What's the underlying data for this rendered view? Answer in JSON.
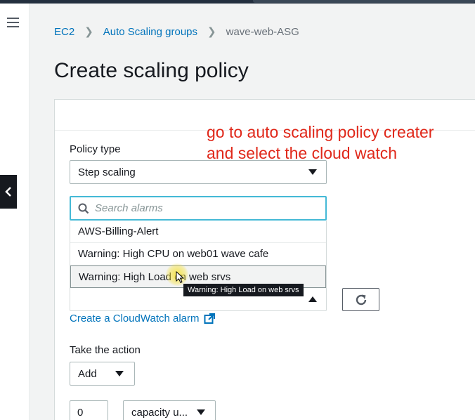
{
  "nav": {
    "menu_icon": "hamburger-menu-icon",
    "back_icon": "chevron-left-icon"
  },
  "breadcrumb": {
    "items": [
      "EC2",
      "Auto Scaling groups"
    ],
    "current": "wave-web-ASG",
    "separator_icon": "chevron-right-icon"
  },
  "page": {
    "title": "Create scaling policy"
  },
  "annotation": {
    "line1": "go to auto scaling policy creater",
    "line2": "and select the cloud watch",
    "color": "#e0281a"
  },
  "form": {
    "policy_type_label": "Policy type",
    "policy_type_value": "Step scaling",
    "search": {
      "placeholder": "Search alarms",
      "icon": "search-icon"
    },
    "alarm_options": [
      "AWS-Billing-Alert",
      "Warning: High CPU on web01 wave cafe",
      "Warning: High Load on web srvs"
    ],
    "hovered_option_index": 2,
    "tooltip": "Warning: High Load on web srvs",
    "refresh_icon": "refresh-icon",
    "create_alarm_link": "Create a CloudWatch alarm",
    "external_link_icon": "external-link-icon",
    "take_action_label": "Take the action",
    "action_value": "Add",
    "amount_value": "0",
    "unit_value": "capacity u..."
  },
  "colors": {
    "link": "#0073bb",
    "focus_border": "#44b9d6",
    "dark_header": "#232f3e"
  }
}
